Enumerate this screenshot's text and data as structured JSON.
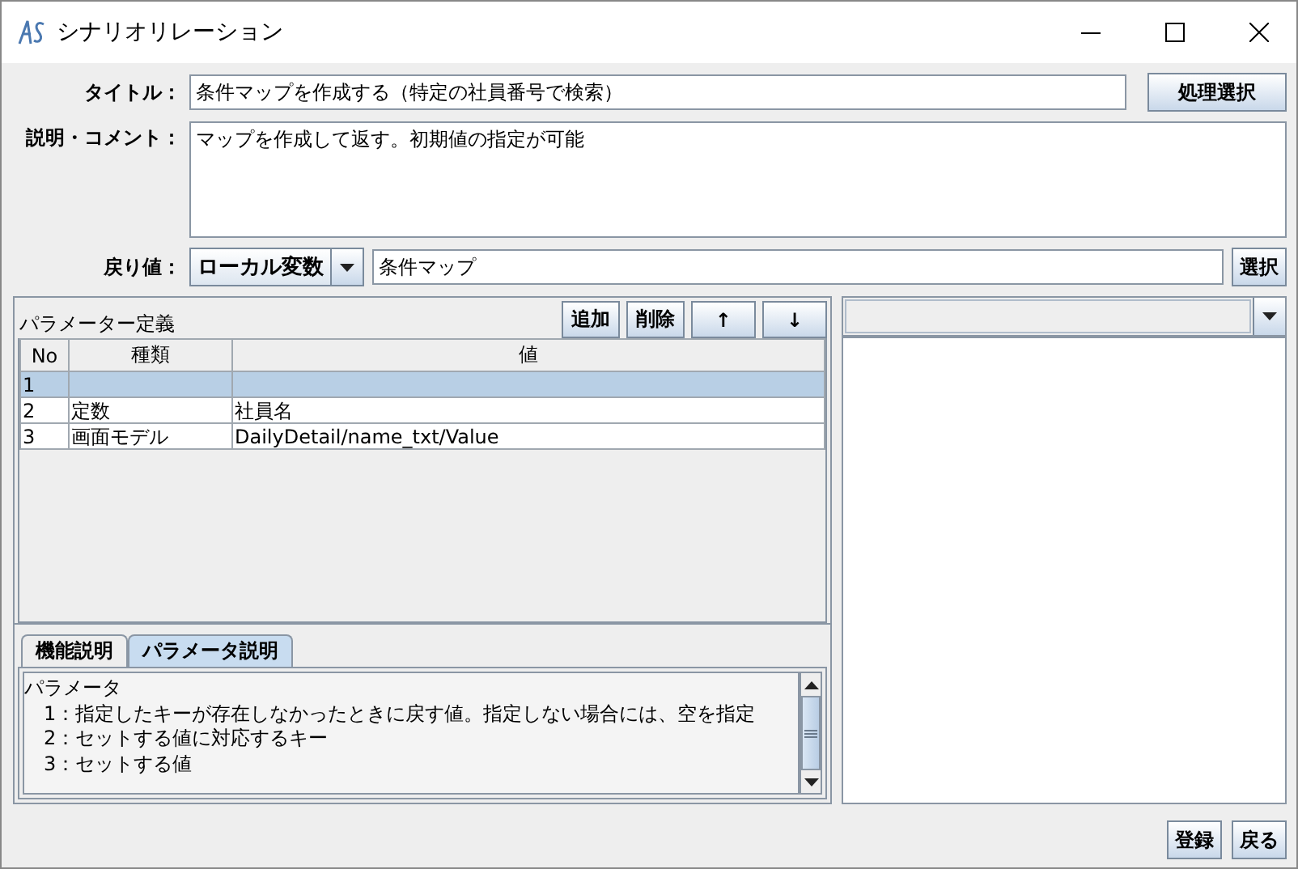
{
  "window": {
    "title": "シナリオリレーション"
  },
  "form": {
    "title_label": "タイトル：",
    "title_value": "条件マップを作成する（特定の社員番号で検索）",
    "process_button": "処理選択",
    "comment_label": "説明・コメント：",
    "comment_value": "マップを作成して返す。初期値の指定が可能",
    "return_label": "戻り値：",
    "return_kind": "ローカル変数",
    "return_value": "条件マップ",
    "select_button": "選択"
  },
  "parameters": {
    "title": "パラメーター定義",
    "buttons": [
      "追加",
      "削除",
      "↑",
      "↓"
    ],
    "columns": [
      "No",
      "種類",
      "値"
    ],
    "rows": [
      {
        "no": "1",
        "kind": "",
        "value": "",
        "selected": true
      },
      {
        "no": "2",
        "kind": "定数",
        "value": "社員名",
        "selected": false
      },
      {
        "no": "3",
        "kind": "画面モデル",
        "value": "DailyDetail/name_txt/Value",
        "selected": false
      }
    ]
  },
  "tabs": [
    {
      "label": "機能説明",
      "selected": false
    },
    {
      "label": "パラメータ説明",
      "selected": true
    }
  ],
  "description_lines": [
    {
      "text": "パラメータ",
      "indent": false
    },
    {
      "text": "1：指定したキーが存在しなかったときに戻す値。指定しない場合には、空を指定",
      "indent": true
    },
    {
      "text": "2：セットする値に対応するキー",
      "indent": true
    },
    {
      "text": "3：セットする値",
      "indent": true
    }
  ],
  "footer_buttons": [
    "登録",
    "戻る"
  ]
}
